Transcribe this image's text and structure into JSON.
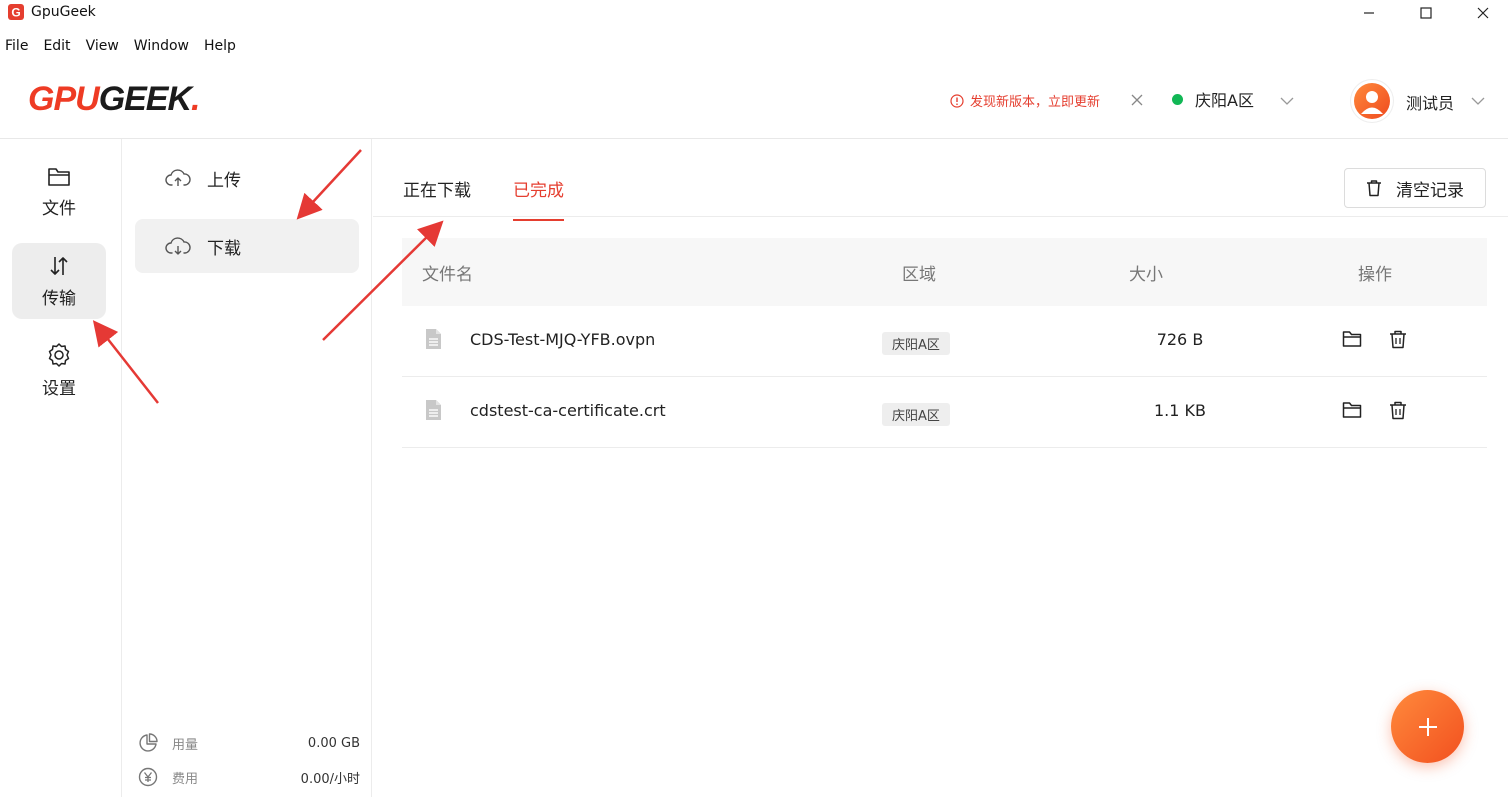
{
  "window": {
    "title": "GpuGeek"
  },
  "menu": {
    "items": [
      "File",
      "Edit",
      "View",
      "Window",
      "Help"
    ]
  },
  "header": {
    "logo_text": "GPUGEEK.",
    "update_notice": "发现新版本，立即更新",
    "region": "庆阳A区",
    "user_name": "测试员"
  },
  "leftnav": {
    "items": [
      {
        "label": "文件",
        "icon": "folder-icon"
      },
      {
        "label": "传输",
        "icon": "transfer-icon",
        "active": true
      },
      {
        "label": "设置",
        "icon": "gear-icon"
      }
    ]
  },
  "subnav": {
    "items": [
      {
        "label": "上传",
        "icon": "cloud-upload-icon"
      },
      {
        "label": "下载",
        "icon": "cloud-download-icon",
        "active": true
      }
    ],
    "usage_label": "用量",
    "usage_value": "0.00 GB",
    "cost_label": "费用",
    "cost_value": "0.00/小时"
  },
  "tabs": [
    {
      "label": "正在下载"
    },
    {
      "label": "已完成",
      "active": true
    }
  ],
  "clear_button": "清空记录",
  "table": {
    "headers": [
      "文件名",
      "区域",
      "大小",
      "操作"
    ],
    "rows": [
      {
        "name": "CDS-Test-MJQ-YFB.ovpn",
        "region": "庆阳A区",
        "size": "726 B"
      },
      {
        "name": "cdstest-ca-certificate.crt",
        "region": "庆阳A区",
        "size": "1.1 KB"
      }
    ]
  },
  "colors": {
    "accent": "#e53e2f",
    "online": "#11b755",
    "fab": "#f2501f"
  }
}
